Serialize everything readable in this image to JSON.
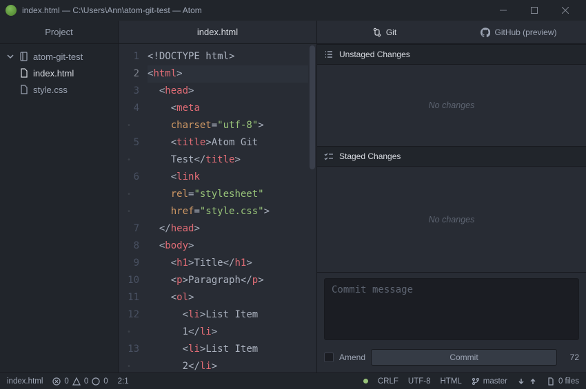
{
  "window": {
    "title": "index.html — C:\\Users\\Ann\\atom-git-test — Atom"
  },
  "sidebar": {
    "header": "Project",
    "root": "atom-git-test",
    "files": [
      "index.html",
      "style.css"
    ],
    "selected_index": 0
  },
  "editor": {
    "tab": "index.html",
    "cursor_line": 2
  },
  "git": {
    "tabs": {
      "git": "Git",
      "github": "GitHub (preview)"
    },
    "unstaged": {
      "title": "Unstaged Changes",
      "empty": "No changes"
    },
    "staged": {
      "title": "Staged Changes",
      "empty": "No changes"
    },
    "commit": {
      "placeholder": "Commit message",
      "amend_label": "Amend",
      "button": "Commit",
      "remaining": "72"
    }
  },
  "status": {
    "file": "index.html",
    "diag": {
      "err": "0",
      "warn": "0",
      "info": "0"
    },
    "cursor": "2:1",
    "eol": "CRLF",
    "encoding": "UTF-8",
    "grammar": "HTML",
    "branch": "master",
    "files_badge": "0 files"
  }
}
